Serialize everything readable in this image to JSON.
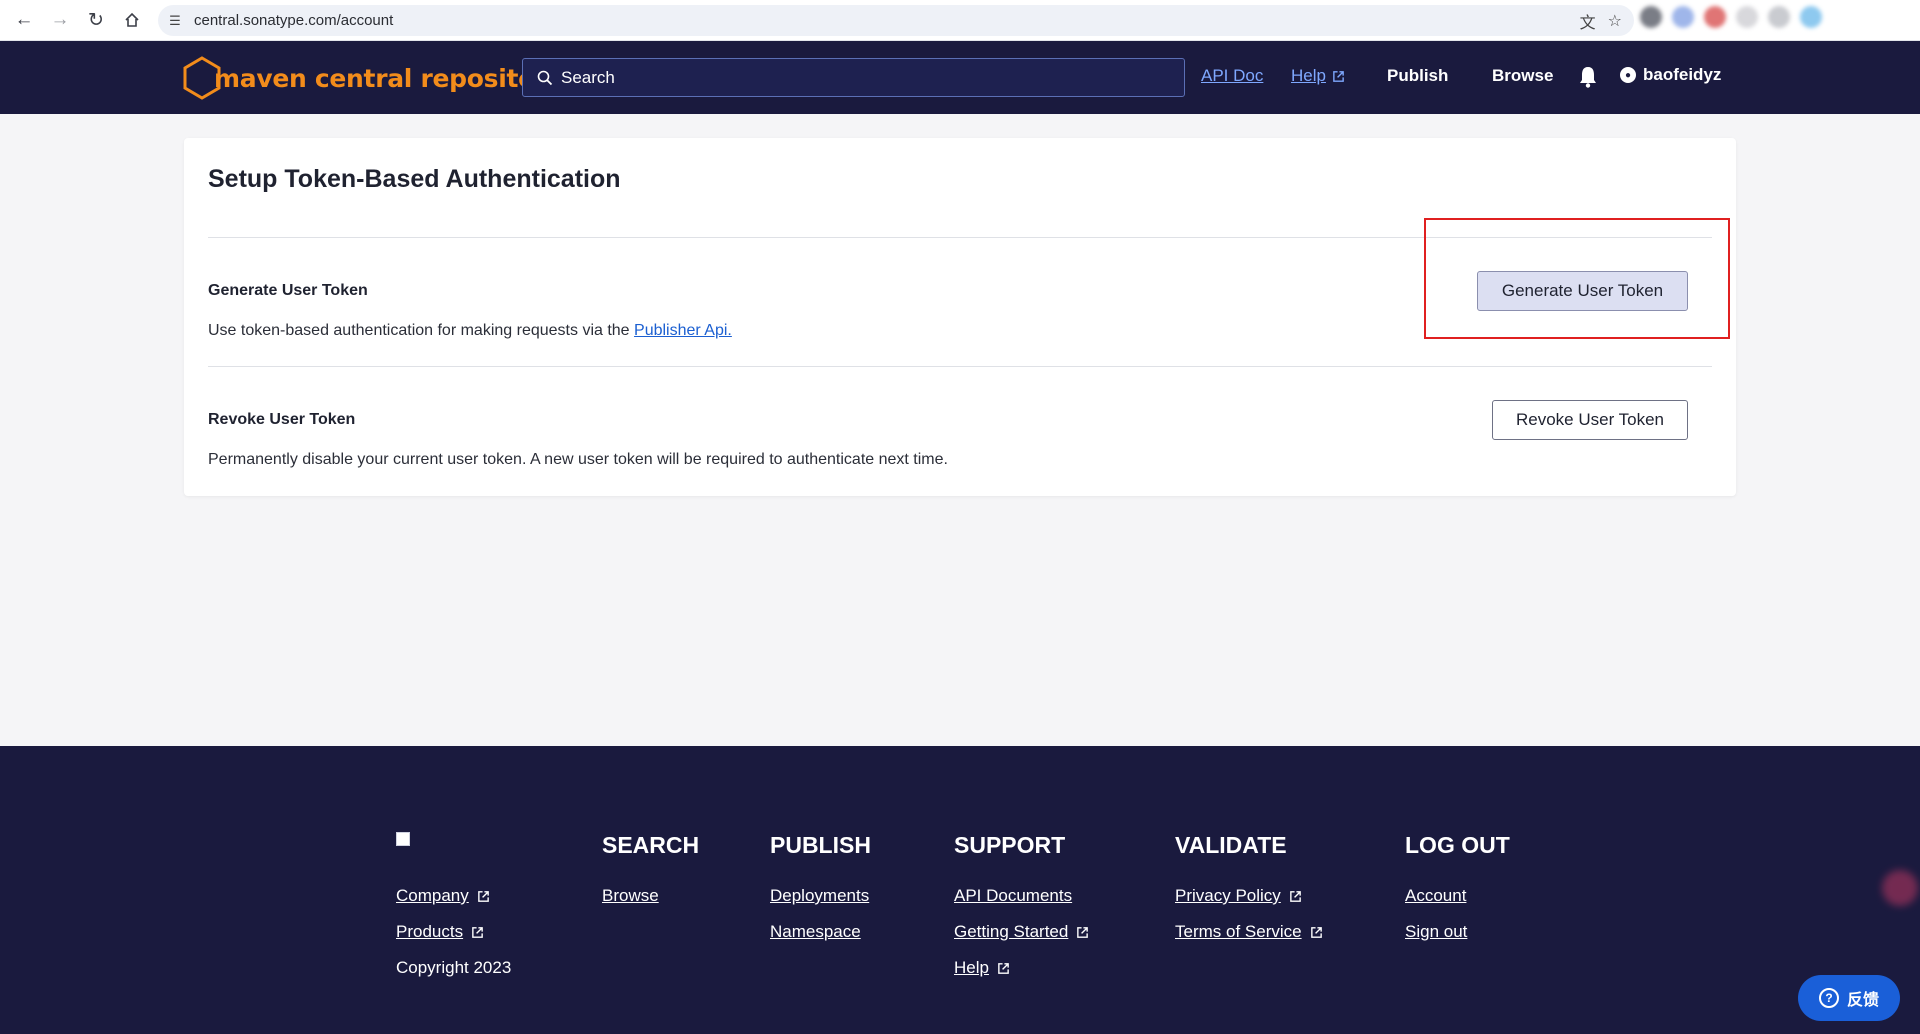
{
  "browser": {
    "url": "central.sonatype.com/account",
    "icons": [
      "back-icon",
      "forward-icon",
      "reload-icon",
      "home-icon",
      "site-settings-icon",
      "translate-icon",
      "bookmark-star-icon"
    ]
  },
  "header": {
    "logo_text": "maven central repository",
    "search_placeholder": "Search",
    "links": {
      "api_doc": "API Doc",
      "help": "Help",
      "publish": "Publish",
      "browse": "Browse"
    },
    "username": "baofeidyz",
    "colors": {
      "background": "#1a1a3e",
      "logo": "#f28c1b",
      "link": "#7fa8ff"
    }
  },
  "card": {
    "title": "Setup Token-Based Authentication",
    "generate": {
      "heading": "Generate User Token",
      "text_prefix": "Use token-based authentication for making requests via the ",
      "link": "Publisher Api.",
      "button": "Generate User Token"
    },
    "revoke": {
      "heading": "Revoke User Token",
      "text": "Permanently disable your current user token. A new user token will be required to authenticate next time.",
      "button": "Revoke User Token"
    },
    "highlight_color": "#e02020"
  },
  "footer": {
    "company": "Company",
    "products": "Products",
    "copyright": "Copyright 2023",
    "columns": {
      "search": {
        "heading": "SEARCH",
        "links": [
          "Browse"
        ]
      },
      "publish": {
        "heading": "PUBLISH",
        "links": [
          "Deployments",
          "Namespace"
        ]
      },
      "support": {
        "heading": "SUPPORT",
        "links": [
          "API Documents",
          "Getting Started",
          "Help"
        ]
      },
      "validate": {
        "heading": "VALIDATE",
        "links": [
          "Privacy Policy",
          "Terms of Service"
        ]
      },
      "logout": {
        "heading": "LOG OUT",
        "links": [
          "Account",
          "Sign out"
        ]
      }
    }
  },
  "feedback": {
    "label": "反馈"
  }
}
